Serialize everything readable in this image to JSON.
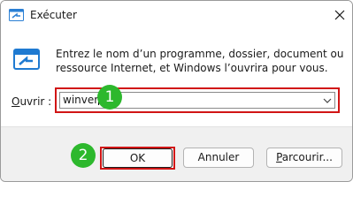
{
  "window": {
    "title": "Exécuter"
  },
  "description": {
    "line1": "Entrez le nom d’un programme, dossier, document ou",
    "line2": "ressource Internet, et Windows l’ouvrira pour vous."
  },
  "open_field": {
    "label_first": "O",
    "label_rest": "uvrir :",
    "value": "winver"
  },
  "buttons": {
    "ok": "OK",
    "cancel": "Annuler",
    "browse_first": "P",
    "browse_rest": "arcourir..."
  },
  "callouts": [
    "1",
    "2"
  ],
  "colors": {
    "callout_green": "#2db82d",
    "highlight_red": "#d11515"
  }
}
